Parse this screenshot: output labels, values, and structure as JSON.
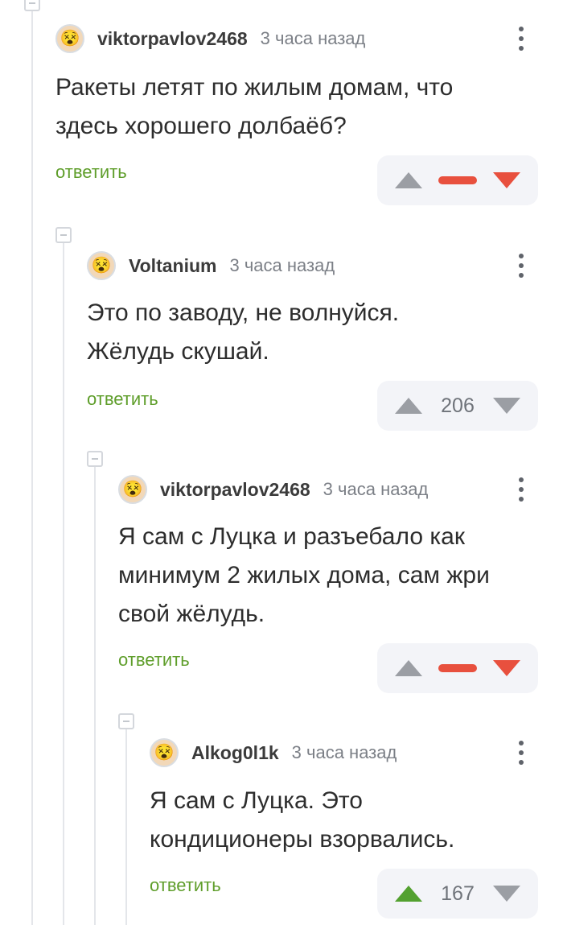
{
  "comments": [
    {
      "username": "viktorpavlov2468",
      "time": "3 часа назад",
      "avatar_icon": "emoji-avatar",
      "text_lines": [
        "Ракеты летят по жилым домам, что",
        "здесь хорошего долбаёб?"
      ],
      "reply_label": "ответить",
      "rating": "",
      "rating_state": "negative"
    },
    {
      "username": "Voltanium",
      "time": "3 часа назад",
      "avatar_icon": "emoji-avatar",
      "text_lines": [
        "Это по заводу, не волнуйся.",
        "Жёлудь скушай."
      ],
      "reply_label": "ответить",
      "rating": "206",
      "rating_state": "neutral"
    },
    {
      "username": "viktorpavlov2468",
      "time": "3 часа назад",
      "avatar_icon": "emoji-avatar",
      "text_lines": [
        "Я сам с Луцка и разъебало как",
        "минимум 2 жилых дома, сам жри",
        "свой жёлудь."
      ],
      "reply_label": "ответить",
      "rating": "",
      "rating_state": "negative"
    },
    {
      "username": "Alkog0l1k",
      "time": "3 часа назад",
      "avatar_icon": "emoji-avatar",
      "text_lines": [
        "Я сам с Луцка. Это",
        "кондиционеры взорвались."
      ],
      "reply_label": "ответить",
      "rating": "167",
      "rating_state": "upvoted"
    }
  ],
  "colors": {
    "reply_link": "#5f9e2b",
    "downvote_active": "#e8503e",
    "upvote_active": "#53a130",
    "vote_bg": "#f3f4f8",
    "thread_line": "#e4e6ea"
  }
}
